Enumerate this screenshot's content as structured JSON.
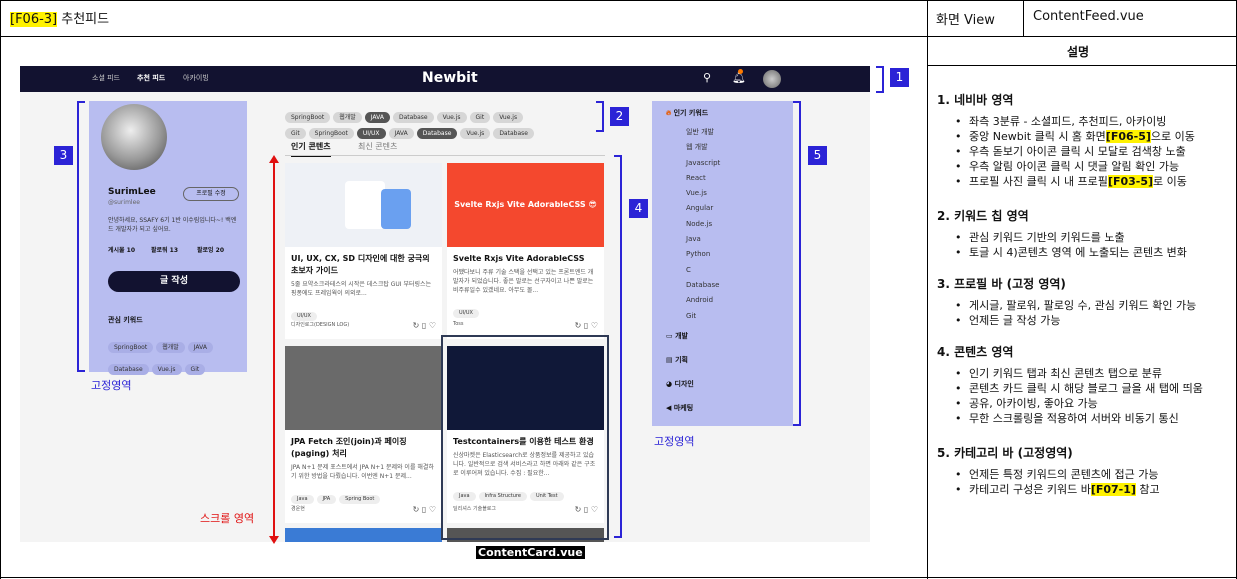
{
  "header": {
    "code": "[F06-3]",
    "title": "추천피드",
    "screen_label": "화면 View",
    "file": "ContentFeed.vue",
    "desc_label": "설명"
  },
  "nav": {
    "links": [
      "소셜 피드",
      "추천 피드",
      "아카이빙"
    ],
    "logo": "Newbit"
  },
  "markers": [
    "1",
    "2",
    "3",
    "4",
    "5"
  ],
  "profile": {
    "name": "SurimLee",
    "handle": "@surimlee",
    "edit": "프로필 수정",
    "bio": "안녕하세요, SSAFY 6기 1반 이수림입니다~! 백엔드 개발자가 되고 싶어요.",
    "posts": "게시물 10",
    "followers": "팔로워 13",
    "following": "팔로잉 20",
    "write": "글 작성",
    "kw_title": "관심 키워드",
    "keywords": [
      "SpringBoot",
      "웹개발",
      "JAVA",
      "Database",
      "Vue.js",
      "Git"
    ]
  },
  "chips_row1": [
    "SpringBoot",
    "웹개발",
    "JAVA",
    "Database",
    "Vue.js",
    "Git",
    "Vue.js"
  ],
  "chips_row2": [
    "Git",
    "SpringBoot",
    "UI/UX",
    "JAVA",
    "Database",
    "Vue.js",
    "Database"
  ],
  "tabs": [
    "인기 콘텐츠",
    "최신 콘텐츠"
  ],
  "cards": [
    {
      "title": "UI, UX, CX, SD 디자인에 대한 궁극의 초보자 가이드",
      "desc": "5줄 요약소크라테스의 시작은 데스크탑 GUI 부터링스는 핑퐁에도 프레임웍이 의외로...",
      "tags": [
        "UI/UX"
      ],
      "author": "디자인로그(DESIGN LOG)"
    },
    {
      "title": "Svelte Rxjs Vite AdorableCSS",
      "desc": "어쨌다보니 주류 기술 스택을 선택고 있는 프론트엔드 개발자가 되었습니다. 좋은 말로는 선구자이고 나쁜 말로는 비주류일수 있겠네요. 아무도 몰...",
      "tags": [
        "UI/UX"
      ],
      "author": "Toss",
      "banner": "Svelte Rxjs Vite AdorableCSS 😎"
    },
    {
      "title": "JPA Fetch 조인(join)과 페이징(paging) 처리",
      "desc": "JPA N+1 문제 포스트에서 JPA N+1 문제와 이를 해결하기 위한 방법을 다뤘습니다. 이번엔 N+1 문제...",
      "tags": [
        "Java",
        "JPA",
        "Spring Boot"
      ],
      "author": "경운현"
    },
    {
      "title": "Testcontainers를 이용한 테스트 환경",
      "desc": "신상마켓은 Elasticsearch로 상품정보를 제공하고 있습니다. 일반적으로 검색 서비스라고 하면 아래와 같은 구조로 이루어져 있습니다. 수집 : 필요한...",
      "tags": [
        "Java",
        "Infra Structure",
        "Unit Test"
      ],
      "author": "딜리셔스 기술블로그"
    }
  ],
  "categories": {
    "head": "인기 키워드",
    "items": [
      "일반 개발",
      "웹 개발",
      "Javascript",
      "React",
      "Vue.js",
      "Angular",
      "Node.js",
      "Java",
      "Python",
      "C",
      "Database",
      "Android",
      "Git"
    ],
    "groups": [
      "개발",
      "기획",
      "디자인",
      "마케팅"
    ]
  },
  "labels": {
    "fixed_left": "고정영역",
    "fixed_right": "고정영역",
    "scroll": "스크롤 영역",
    "card_caption": "ContentCard.vue"
  },
  "desc": [
    {
      "h": "1.   네비바 영역",
      "items": [
        [
          "좌측 3분류 - 소셜피드, 추천피드, 아카이빙",
          "",
          ""
        ],
        [
          "중앙 Newbit 클릭 시 홈 화면",
          "[F06-5]",
          "으로 이동"
        ],
        [
          "우측 돋보기 아이콘 클릭 시 모달로 검색창 노출",
          "",
          ""
        ],
        [
          "우측 알림 아이콘 클릭 시 댓글 알림 확인 가능",
          "",
          ""
        ],
        [
          "프로필 사진 클릭 시 내 프로필",
          "[F03-5]",
          "로 이동"
        ]
      ]
    },
    {
      "h": "2.   키워드 칩 영역",
      "items": [
        [
          "관심 키워드 기반의 키워드를 노출",
          "",
          ""
        ],
        [
          "토글 시 4)콘텐츠 영역 에 노출되는 콘텐츠 변화",
          "",
          ""
        ]
      ]
    },
    {
      "h": "3.   프로필 바 (고정 영역)",
      "items": [
        [
          "게시글, 팔로워, 팔로잉 수, 관심 키워드 확인 가능",
          "",
          ""
        ],
        [
          "언제든 글 작성 가능",
          "",
          ""
        ]
      ]
    },
    {
      "h": "4.   콘텐츠 영역",
      "items": [
        [
          "인기 키워드 탭과 최신 콘텐츠 탭으로 분류",
          "",
          ""
        ],
        [
          "콘텐츠 카드 클릭 시 해당 블로그 글을 새 탭에 띄움",
          "",
          ""
        ],
        [
          "공유, 아카이빙, 좋아요 가능",
          "",
          ""
        ],
        [
          "무한 스크롤링을 적용하여 서버와 비동기 통신",
          "",
          ""
        ]
      ]
    },
    {
      "h": "5.   카테고리 바 (고정영역)",
      "items": [
        [
          "언제든 특정 키워드의 콘텐츠에 접근 가능",
          "",
          ""
        ],
        [
          "카테고리 구성은 키워드 바",
          "[F07-1]",
          " 참고"
        ]
      ]
    }
  ]
}
